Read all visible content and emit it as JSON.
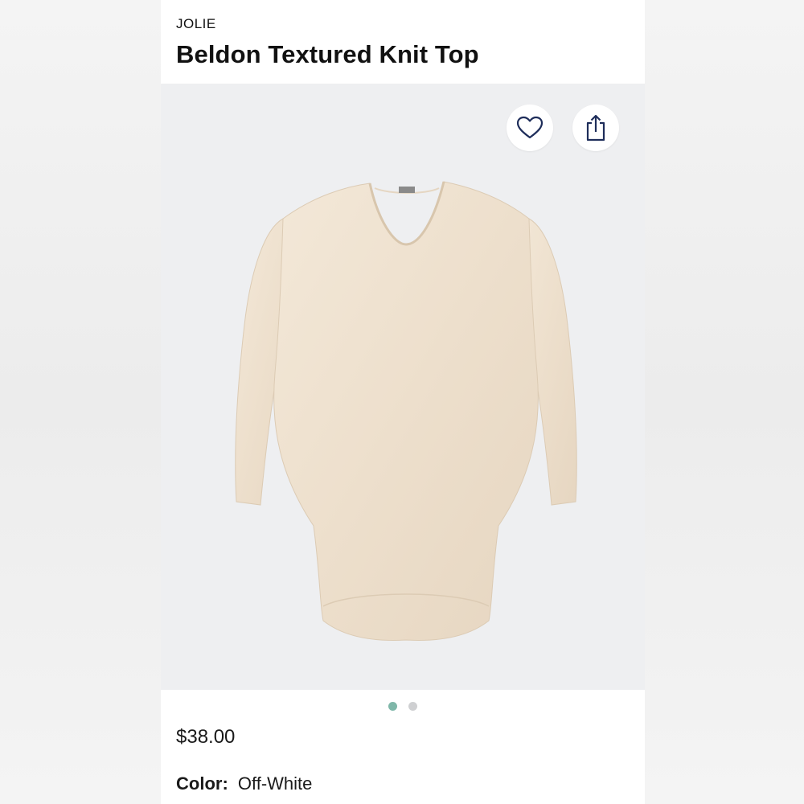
{
  "product": {
    "brand": "JOLIE",
    "name": "Beldon Textured Knit Top",
    "price": "$38.00",
    "color_label": "Color:",
    "color_value": "Off-White",
    "garment_color": "#efe2d1"
  },
  "gallery": {
    "image_count": 2,
    "active_index": 0,
    "dot_active_color": "#7fb7a9",
    "dot_inactive_color": "#cfd0d2"
  },
  "actions": {
    "favorite_icon": "heart-icon",
    "share_icon": "share-icon",
    "icon_color": "#1e2d5a"
  }
}
